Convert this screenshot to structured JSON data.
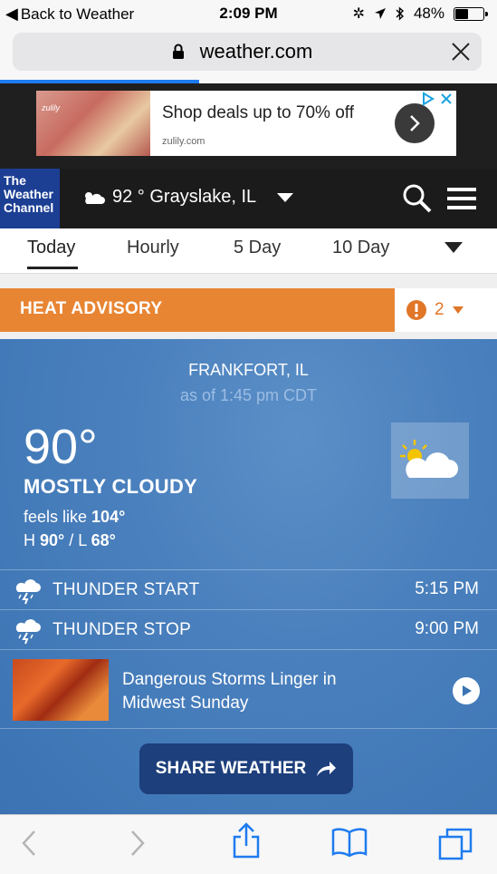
{
  "status_bar": {
    "back_label": "Back to Weather",
    "time": "2:09 PM",
    "battery": "48%",
    "battery_level": 0.48
  },
  "browser": {
    "url": "weather.com",
    "load_progress": 0.4
  },
  "ad": {
    "headline": "Shop deals up to 70% off",
    "domain": "zulily.com",
    "brand": "zulily"
  },
  "header": {
    "logo_line1": "The",
    "logo_line2": "Weather",
    "logo_line3": "Channel",
    "location": "92 ° Grayslake, IL"
  },
  "tabs": [
    {
      "label": "Today"
    },
    {
      "label": "Hourly"
    },
    {
      "label": "5 Day"
    },
    {
      "label": "10 Day"
    }
  ],
  "advisory": {
    "label": "HEAT ADVISORY",
    "count": "2"
  },
  "current": {
    "location": "FRANKFORT, IL",
    "as_of": "as of 1:45 pm CDT",
    "temperature": "90°",
    "condition": "MOSTLY CLOUDY",
    "feels_prefix": "feels like ",
    "feels_value": "104°",
    "hl_h_prefix": "H ",
    "high": "90°",
    "hl_sep": " / L ",
    "low": "68°"
  },
  "alerts": [
    {
      "label": "THUNDER START",
      "time": "5:15 PM"
    },
    {
      "label": "THUNDER STOP",
      "time": "9:00 PM"
    }
  ],
  "news": {
    "title": "Dangerous Storms Linger in Midwest Sunday"
  },
  "share_label": "SHARE WEATHER",
  "colors": {
    "advisory": "#e88533",
    "sky": "#4a80bd",
    "share_button": "#1d3f7c",
    "logo": "#1c3f94",
    "progress": "#1e7bf0"
  }
}
